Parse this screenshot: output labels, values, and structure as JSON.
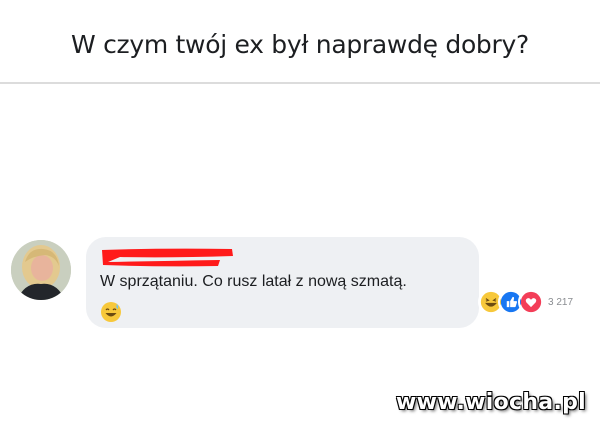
{
  "header": {
    "title": "W czym twój ex był naprawdę dobry?"
  },
  "comment": {
    "author_avatar": "avatar-icon",
    "text": "W sprzątaniu. Co rusz latał z nową szmatą.",
    "emoji": "grinning-sweat-emoji",
    "reactions": {
      "icons": [
        "haha-reaction-icon",
        "like-reaction-icon",
        "love-reaction-icon"
      ],
      "count": "3 217"
    }
  },
  "watermark": {
    "text": "www.wiocha.pl"
  },
  "colors": {
    "bubble_bg": "#eef0f3",
    "redaction": "#ff1a1a",
    "like_blue": "#1877f2",
    "love_red": "#f33e58",
    "haha_yellow": "#f7c83b"
  }
}
